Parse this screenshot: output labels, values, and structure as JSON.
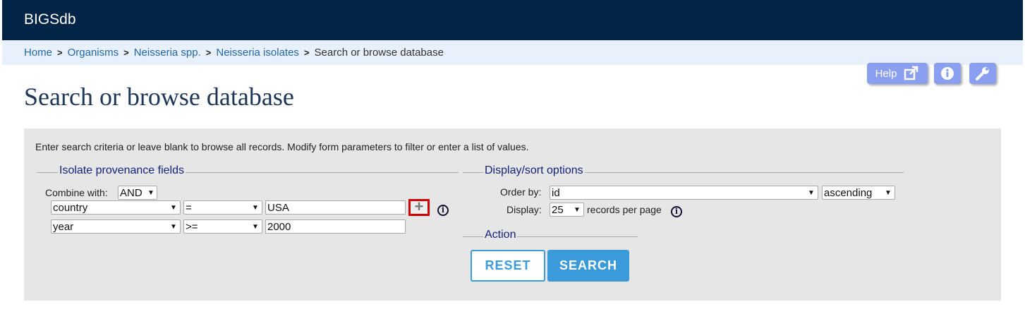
{
  "header": {
    "brand": "BIGSdb"
  },
  "breadcrumb": {
    "items": [
      "Home",
      "Organisms",
      "Neisseria spp.",
      "Neisseria isolates"
    ],
    "separator": ">",
    "current": "Search or browse database"
  },
  "toolbar": {
    "help_label": "Help"
  },
  "page": {
    "title": "Search or browse database"
  },
  "form": {
    "intro": "Enter search criteria or leave blank to browse all records. Modify form parameters to filter or enter a list of values.",
    "provenance": {
      "legend": "Isolate provenance fields",
      "combine_label": "Combine with:",
      "combine_value": "AND",
      "rows": [
        {
          "field": "country",
          "operator": "=",
          "value": "USA"
        },
        {
          "field": "year",
          "operator": ">=",
          "value": "2000"
        }
      ]
    },
    "display": {
      "legend": "Display/sort options",
      "order_label": "Order by:",
      "order_value": "id",
      "direction_value": "ascending",
      "display_label": "Display:",
      "display_value": "25",
      "records_label": "records per page"
    },
    "action": {
      "legend": "Action",
      "reset_label": "RESET",
      "search_label": "SEARCH"
    }
  },
  "colors": {
    "header_bg": "#022547",
    "breadcrumb_bg": "#e8f1fb",
    "accent": "#3b9ad9",
    "toolbar_button": "#8a9ff0",
    "highlight": "#d40000"
  }
}
